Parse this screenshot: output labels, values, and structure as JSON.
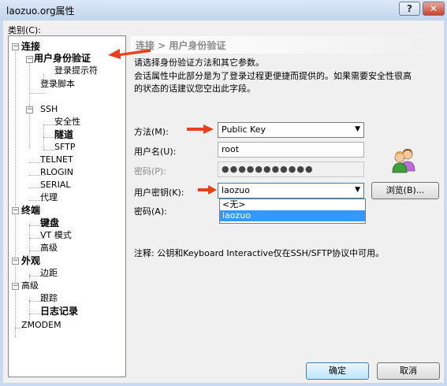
{
  "window": {
    "title": "laozuo.org属性",
    "help_glyph": "?",
    "close_glyph": "✕"
  },
  "category_label": "类别(C):",
  "tree": {
    "n0": "连接",
    "n1": "用户身份验证",
    "n2": "登录提示符",
    "n3": "登录脚本",
    "n4": "SSH",
    "n5": "安全性",
    "n6": "隧道",
    "n7": "SFTP",
    "n8": "TELNET",
    "n9": "RLOGIN",
    "n10": "SERIAL",
    "n11": "代理",
    "n12": "终端",
    "n13": "键盘",
    "n14": "VT 模式",
    "n15": "高级",
    "n16": "外观",
    "n17": "边距",
    "n18": "高级",
    "n19": "跟踪",
    "n20": "日志记录",
    "n21": "ZMODEM",
    "expander_minus": "−"
  },
  "panel": {
    "breadcrumb": "连接 > 用户身份验证",
    "desc1": "请选择身份验证方法和其它参数。",
    "desc2": "会话属性中此部分是为了登录过程更便捷而提供的。如果需要安全性很高",
    "desc3": "的状态的话建议您空出此字段。"
  },
  "form": {
    "method_label": "方法(M):",
    "method_value": "Public Key",
    "username_label": "用户名(U):",
    "username_value": "root",
    "password_label": "密码(P):",
    "password_value": "●●●●●●●●●●●",
    "userkey_label": "用户密钥(K):",
    "userkey_value": "laozuo",
    "passphrase_label": "密码(A):",
    "browse_label": "浏览(B)...",
    "dropdown_options": [
      "<无>",
      "laozuo"
    ],
    "combo_arrow": "▼"
  },
  "note": "注释: 公钥和Keyboard Interactive仅在SSH/SFTP协议中可用。",
  "buttons": {
    "ok": "确定",
    "cancel": "取消"
  },
  "colors": {
    "annotation_arrow": "#e8401c",
    "selection": "#3399ff",
    "window_frame": "#c9daf0"
  }
}
